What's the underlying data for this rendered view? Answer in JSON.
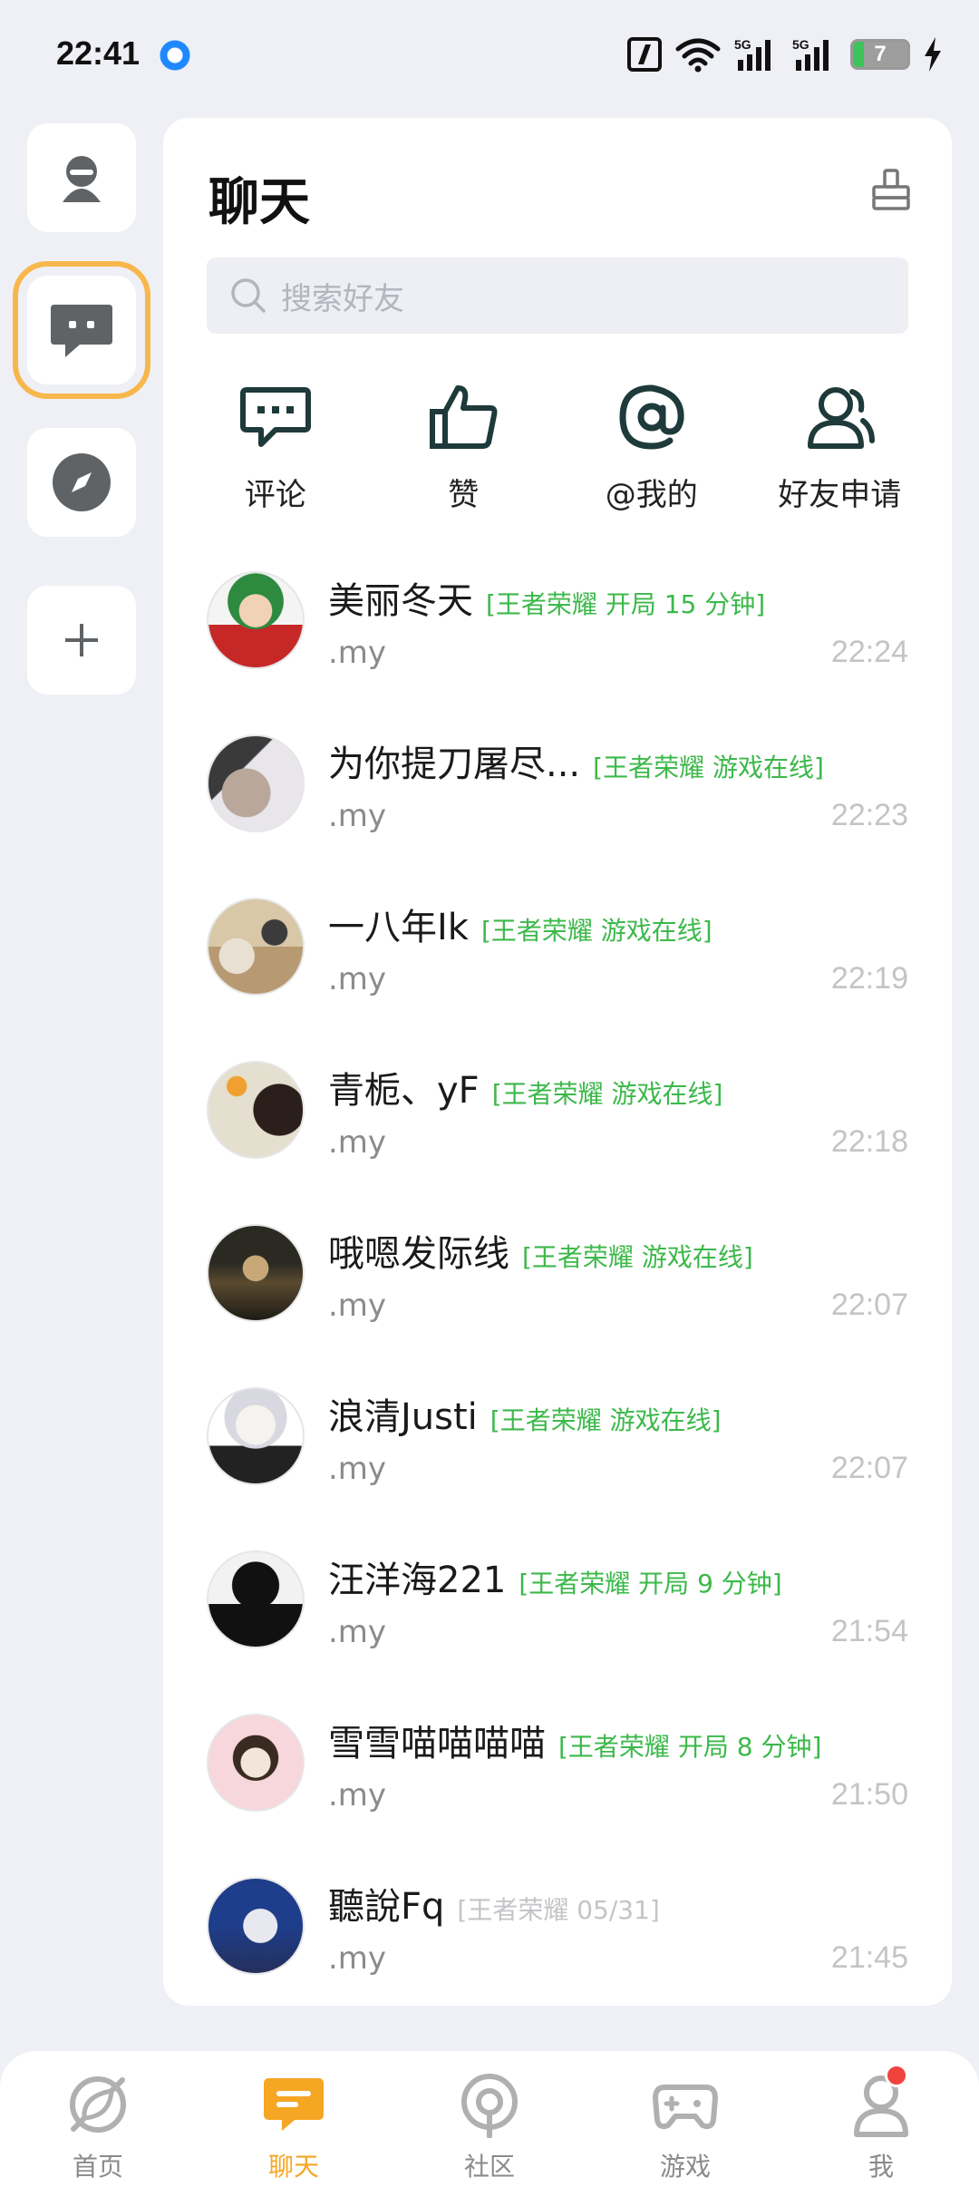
{
  "status_bar": {
    "time": "22:41",
    "signal_label_1": "5G",
    "signal_label_2": "5G",
    "battery_level": "7"
  },
  "left_rail": {
    "items": [
      {
        "icon": "profile-icon"
      },
      {
        "icon": "chat-bubble-icon",
        "active": true
      },
      {
        "icon": "compass-icon"
      },
      {
        "icon": "plus-icon"
      }
    ]
  },
  "header": {
    "title": "聊天",
    "clear_icon": "broom-icon"
  },
  "search": {
    "placeholder": "搜索好友"
  },
  "quick_actions": [
    {
      "label": "评论",
      "icon": "comment-icon"
    },
    {
      "label": "赞",
      "icon": "thumbs-up-icon"
    },
    {
      "label": "@我的",
      "icon": "at-icon"
    },
    {
      "label": "好友申请",
      "icon": "friend-request-icon"
    }
  ],
  "chats": [
    {
      "name": "美丽冬天",
      "status": "[王者荣耀 开局 15 分钟]",
      "preview": ".my",
      "time": "22:24",
      "status_color": "#3cb84a"
    },
    {
      "name": "为你提刀屠尽...",
      "status": "[王者荣耀 游戏在线]",
      "preview": ".my",
      "time": "22:23",
      "status_color": "#3cb84a"
    },
    {
      "name": "一八年Ik",
      "status": "[王者荣耀 游戏在线]",
      "preview": ".my",
      "time": "22:19",
      "status_color": "#3cb84a"
    },
    {
      "name": "青栀、yF",
      "status": "[王者荣耀 游戏在线]",
      "preview": ".my",
      "time": "22:18",
      "status_color": "#3cb84a"
    },
    {
      "name": "哦嗯发际线",
      "status": "[王者荣耀 游戏在线]",
      "preview": ".my",
      "time": "22:07",
      "status_color": "#3cb84a"
    },
    {
      "name": "浪清Justi",
      "status": "[王者荣耀 游戏在线]",
      "preview": ".my",
      "time": "22:07",
      "status_color": "#3cb84a"
    },
    {
      "name": "汪洋海221",
      "status": "[王者荣耀 开局 9 分钟]",
      "preview": ".my",
      "time": "21:54",
      "status_color": "#3cb84a"
    },
    {
      "name": "雪雪喵喵喵喵",
      "status": "[王者荣耀 开局 8 分钟]",
      "preview": ".my",
      "time": "21:50",
      "status_color": "#3cb84a"
    },
    {
      "name": "聽說Fq",
      "status": "[王者荣耀 05/31]",
      "preview": ".my",
      "time": "21:45",
      "status_color": "#c4c4c8"
    }
  ],
  "bottom_nav": [
    {
      "label": "首页",
      "icon": "home-leaf-icon",
      "active": false
    },
    {
      "label": "聊天",
      "icon": "chat-icon",
      "active": true
    },
    {
      "label": "社区",
      "icon": "community-icon",
      "active": false
    },
    {
      "label": "游戏",
      "icon": "gamepad-icon",
      "active": false
    },
    {
      "label": "我",
      "icon": "person-icon",
      "active": false,
      "badge": true
    }
  ],
  "colors": {
    "accent": "#f5a623",
    "online_green": "#3cb84a",
    "badge_red": "#f0433e"
  }
}
